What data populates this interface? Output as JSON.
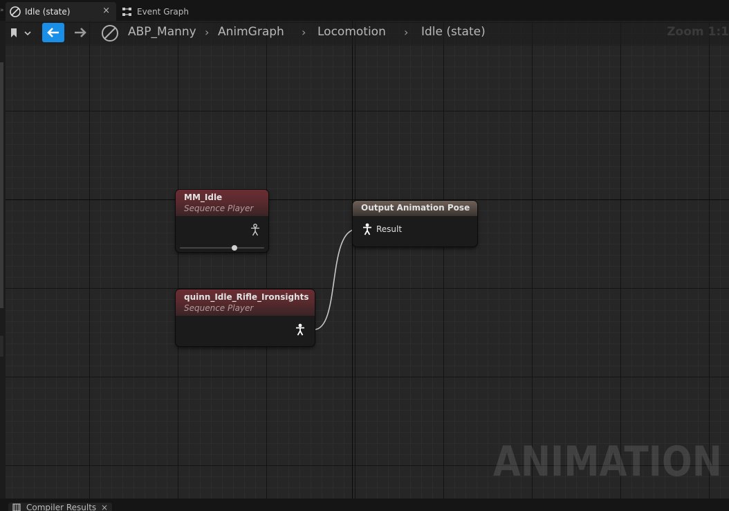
{
  "tabs": [
    {
      "label": "Idle (state)",
      "active": true,
      "close_glyph": "×",
      "icon": "state-icon"
    },
    {
      "label": "Event Graph",
      "active": false,
      "icon": "event-graph-icon"
    }
  ],
  "breadcrumb": {
    "items": [
      "ABP_Manny",
      "AnimGraph",
      "Locomotion",
      "Idle (state)"
    ],
    "separator": "›"
  },
  "zoom_label": "Zoom 1:1",
  "nodes": {
    "mm_idle": {
      "title": "MM_Idle",
      "subtitle": "Sequence Player",
      "slider_value": 0.65
    },
    "quinn": {
      "title": "quinn_Idle_Rifle_Ironsights",
      "subtitle": "Sequence Player"
    },
    "output": {
      "title": "Output Animation Pose",
      "pin_label": "Result"
    }
  },
  "watermark": "ANIMATION",
  "bottom_tab": {
    "label": "Compiler Results",
    "close_glyph": "×"
  },
  "colors": {
    "accent_blue": "#1a8fe8",
    "sequence_header": "#6a2d33",
    "output_header": "#6e6058",
    "graph_bg": "#262626"
  }
}
